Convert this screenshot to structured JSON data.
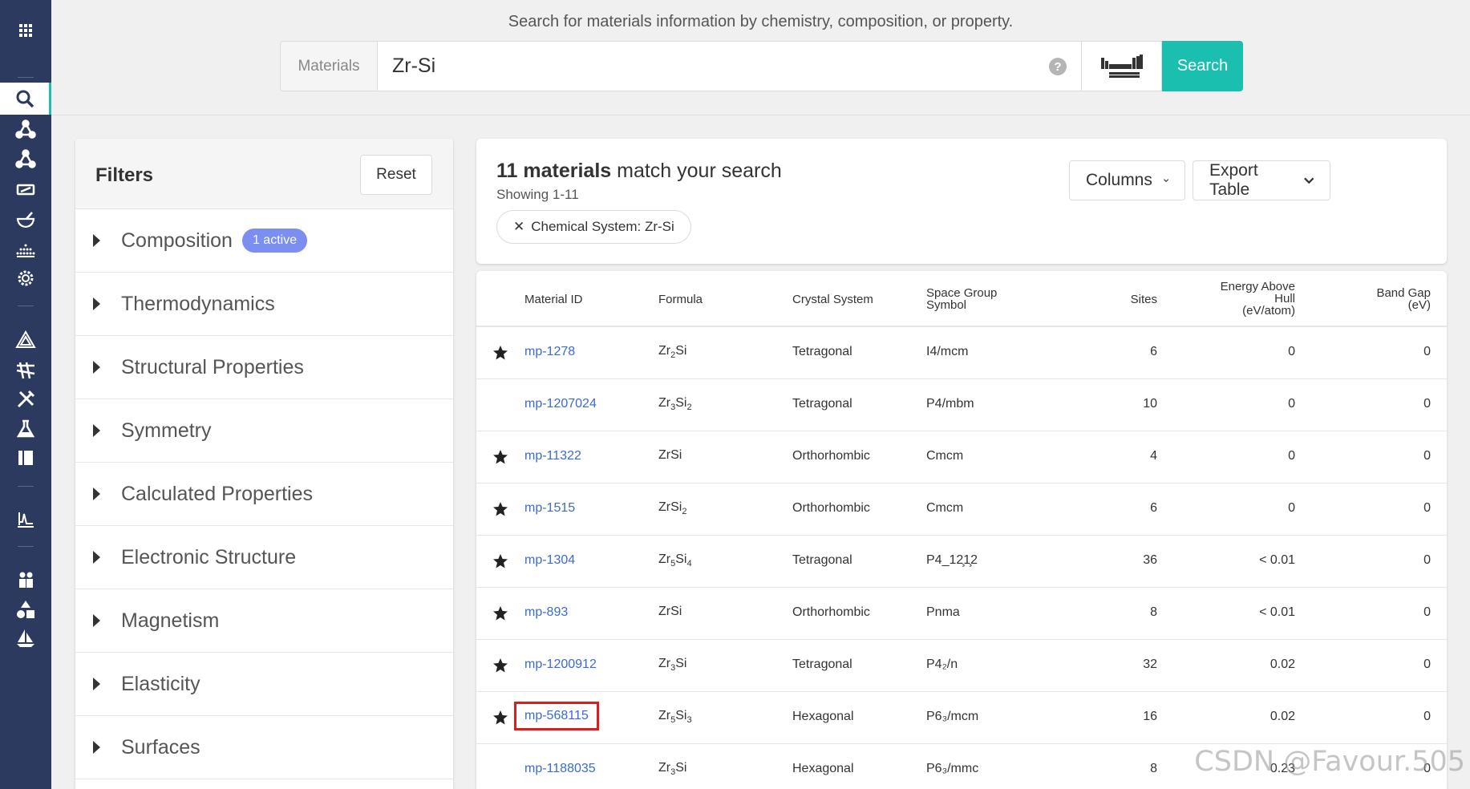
{
  "sidebar": {
    "icons": [
      "apps-icon",
      "search-icon",
      "molecule-icon",
      "molecule-icon",
      "battery-icon",
      "mortar-pestle-icon",
      "surface-icon",
      "gear-icon",
      "triangle-icon",
      "bridge-icon",
      "tools-icon",
      "flask-icon",
      "book-icon",
      "spectrum-icon",
      "people-icon",
      "shapes-icon",
      "sailboat-icon"
    ],
    "accent": "#1bbfaf",
    "bg": "#2c3a5f"
  },
  "search": {
    "caption": "Search for materials information by chemistry, composition, or property.",
    "addon": "Materials",
    "value": "Zr-Si",
    "help": "?",
    "button": "Search"
  },
  "filters": {
    "title": "Filters",
    "reset": "Reset",
    "items": [
      {
        "label": "Composition",
        "badge": "1 active"
      },
      {
        "label": "Thermodynamics"
      },
      {
        "label": "Structural Properties"
      },
      {
        "label": "Symmetry"
      },
      {
        "label": "Calculated Properties"
      },
      {
        "label": "Electronic Structure"
      },
      {
        "label": "Magnetism"
      },
      {
        "label": "Elasticity"
      },
      {
        "label": "Surfaces"
      }
    ]
  },
  "results": {
    "count": "11 materials",
    "title_rest": "match your search",
    "showing": "Showing 1-11",
    "chip": "Chemical System: Zr-Si",
    "columns_btn": "Columns",
    "export_btn": "Export Table"
  },
  "table": {
    "headers": {
      "material_id": "Material ID",
      "formula": "Formula",
      "crystal_system": "Crystal System",
      "space_group_1": "Space Group",
      "space_group_2": "Symbol",
      "sites": "Sites",
      "ehull_1": "Energy Above",
      "ehull_2": "Hull",
      "ehull_3": "(eV/atom)",
      "bandgap_1": "Band Gap",
      "bandgap_2": "(eV)"
    },
    "rows": [
      {
        "starred": true,
        "id": "mp-1278",
        "formula": [
          [
            "Zr",
            ""
          ],
          [
            "",
            "2"
          ],
          [
            "Si",
            ""
          ]
        ],
        "crystal": "Tetragonal",
        "sg": "I4/mcm",
        "sites": "6",
        "ehull": "0",
        "gap": "0"
      },
      {
        "starred": false,
        "id": "mp-1207024",
        "formula": [
          [
            "Zr",
            ""
          ],
          [
            "",
            "3"
          ],
          [
            "Si",
            ""
          ],
          [
            "",
            "2"
          ]
        ],
        "crystal": "Tetragonal",
        "sg": "P4/mbm",
        "sites": "10",
        "ehull": "0",
        "gap": "0"
      },
      {
        "starred": true,
        "id": "mp-11322",
        "formula": [
          [
            "ZrSi",
            ""
          ]
        ],
        "crystal": "Orthorhombic",
        "sg": "Cmcm",
        "sites": "4",
        "ehull": "0",
        "gap": "0"
      },
      {
        "starred": true,
        "id": "mp-1515",
        "formula": [
          [
            "ZrSi",
            ""
          ],
          [
            "",
            "2"
          ]
        ],
        "crystal": "Orthorhombic",
        "sg": "Cmcm",
        "sites": "6",
        "ehull": "0",
        "gap": "0"
      },
      {
        "starred": true,
        "id": "mp-1304",
        "formula": [
          [
            "Zr",
            ""
          ],
          [
            "",
            "5"
          ],
          [
            "Si",
            ""
          ],
          [
            "",
            "4"
          ]
        ],
        "crystal": "Tetragonal",
        "sg": "P4_12̧1̧2",
        "sites": "36",
        "ehull": "< 0.01",
        "gap": "0"
      },
      {
        "starred": true,
        "id": "mp-893",
        "formula": [
          [
            "ZrSi",
            ""
          ]
        ],
        "crystal": "Orthorhombic",
        "sg": "Pnma",
        "sites": "8",
        "ehull": "< 0.01",
        "gap": "0"
      },
      {
        "starred": true,
        "id": "mp-1200912",
        "formula": [
          [
            "Zr",
            ""
          ],
          [
            "",
            "3"
          ],
          [
            "Si",
            ""
          ]
        ],
        "crystal": "Tetragonal",
        "sg": "P4₂/n",
        "sites": "32",
        "ehull": "0.02",
        "gap": "0"
      },
      {
        "starred": true,
        "id": "mp-568115",
        "highlight": true,
        "formula": [
          [
            "Zr",
            ""
          ],
          [
            "",
            "5"
          ],
          [
            "Si",
            ""
          ],
          [
            "",
            "3"
          ]
        ],
        "crystal": "Hexagonal",
        "sg": "P6₃/mcm",
        "sites": "16",
        "ehull": "0.02",
        "gap": "0"
      },
      {
        "starred": false,
        "id": "mp-1188035",
        "formula": [
          [
            "Zr",
            ""
          ],
          [
            "",
            "3"
          ],
          [
            "Si",
            ""
          ]
        ],
        "crystal": "Hexagonal",
        "sg": "P6₃/mmc",
        "sites": "8",
        "ehull": "0.23",
        "gap": "0"
      }
    ]
  },
  "watermark": "CSDN @Favour.505"
}
